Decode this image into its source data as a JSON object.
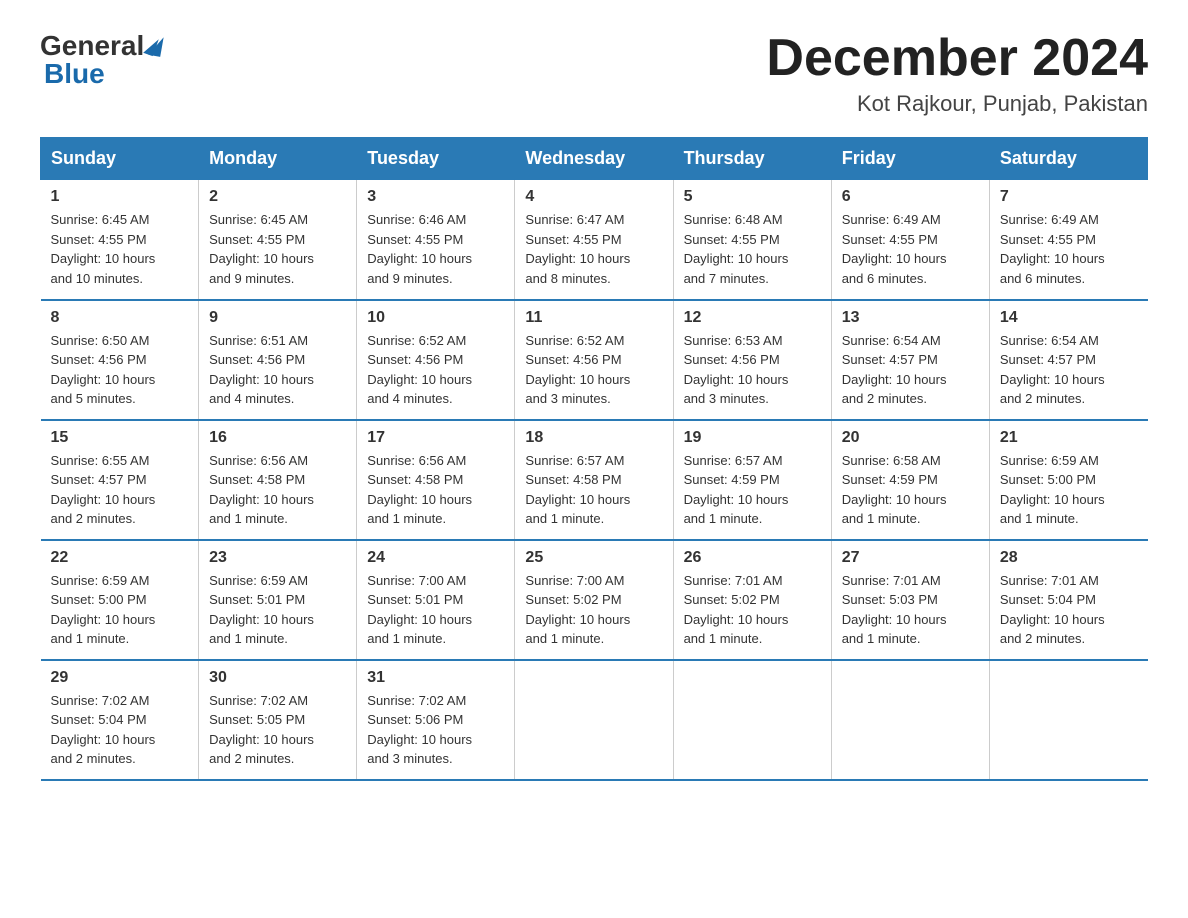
{
  "header": {
    "logo_general": "General",
    "logo_blue": "Blue",
    "main_title": "December 2024",
    "subtitle": "Kot Rajkour, Punjab, Pakistan"
  },
  "days_of_week": [
    "Sunday",
    "Monday",
    "Tuesday",
    "Wednesday",
    "Thursday",
    "Friday",
    "Saturday"
  ],
  "weeks": [
    [
      {
        "day": "1",
        "sunrise": "6:45 AM",
        "sunset": "4:55 PM",
        "daylight": "10 hours and 10 minutes."
      },
      {
        "day": "2",
        "sunrise": "6:45 AM",
        "sunset": "4:55 PM",
        "daylight": "10 hours and 9 minutes."
      },
      {
        "day": "3",
        "sunrise": "6:46 AM",
        "sunset": "4:55 PM",
        "daylight": "10 hours and 9 minutes."
      },
      {
        "day": "4",
        "sunrise": "6:47 AM",
        "sunset": "4:55 PM",
        "daylight": "10 hours and 8 minutes."
      },
      {
        "day": "5",
        "sunrise": "6:48 AM",
        "sunset": "4:55 PM",
        "daylight": "10 hours and 7 minutes."
      },
      {
        "day": "6",
        "sunrise": "6:49 AM",
        "sunset": "4:55 PM",
        "daylight": "10 hours and 6 minutes."
      },
      {
        "day": "7",
        "sunrise": "6:49 AM",
        "sunset": "4:55 PM",
        "daylight": "10 hours and 6 minutes."
      }
    ],
    [
      {
        "day": "8",
        "sunrise": "6:50 AM",
        "sunset": "4:56 PM",
        "daylight": "10 hours and 5 minutes."
      },
      {
        "day": "9",
        "sunrise": "6:51 AM",
        "sunset": "4:56 PM",
        "daylight": "10 hours and 4 minutes."
      },
      {
        "day": "10",
        "sunrise": "6:52 AM",
        "sunset": "4:56 PM",
        "daylight": "10 hours and 4 minutes."
      },
      {
        "day": "11",
        "sunrise": "6:52 AM",
        "sunset": "4:56 PM",
        "daylight": "10 hours and 3 minutes."
      },
      {
        "day": "12",
        "sunrise": "6:53 AM",
        "sunset": "4:56 PM",
        "daylight": "10 hours and 3 minutes."
      },
      {
        "day": "13",
        "sunrise": "6:54 AM",
        "sunset": "4:57 PM",
        "daylight": "10 hours and 2 minutes."
      },
      {
        "day": "14",
        "sunrise": "6:54 AM",
        "sunset": "4:57 PM",
        "daylight": "10 hours and 2 minutes."
      }
    ],
    [
      {
        "day": "15",
        "sunrise": "6:55 AM",
        "sunset": "4:57 PM",
        "daylight": "10 hours and 2 minutes."
      },
      {
        "day": "16",
        "sunrise": "6:56 AM",
        "sunset": "4:58 PM",
        "daylight": "10 hours and 1 minute."
      },
      {
        "day": "17",
        "sunrise": "6:56 AM",
        "sunset": "4:58 PM",
        "daylight": "10 hours and 1 minute."
      },
      {
        "day": "18",
        "sunrise": "6:57 AM",
        "sunset": "4:58 PM",
        "daylight": "10 hours and 1 minute."
      },
      {
        "day": "19",
        "sunrise": "6:57 AM",
        "sunset": "4:59 PM",
        "daylight": "10 hours and 1 minute."
      },
      {
        "day": "20",
        "sunrise": "6:58 AM",
        "sunset": "4:59 PM",
        "daylight": "10 hours and 1 minute."
      },
      {
        "day": "21",
        "sunrise": "6:59 AM",
        "sunset": "5:00 PM",
        "daylight": "10 hours and 1 minute."
      }
    ],
    [
      {
        "day": "22",
        "sunrise": "6:59 AM",
        "sunset": "5:00 PM",
        "daylight": "10 hours and 1 minute."
      },
      {
        "day": "23",
        "sunrise": "6:59 AM",
        "sunset": "5:01 PM",
        "daylight": "10 hours and 1 minute."
      },
      {
        "day": "24",
        "sunrise": "7:00 AM",
        "sunset": "5:01 PM",
        "daylight": "10 hours and 1 minute."
      },
      {
        "day": "25",
        "sunrise": "7:00 AM",
        "sunset": "5:02 PM",
        "daylight": "10 hours and 1 minute."
      },
      {
        "day": "26",
        "sunrise": "7:01 AM",
        "sunset": "5:02 PM",
        "daylight": "10 hours and 1 minute."
      },
      {
        "day": "27",
        "sunrise": "7:01 AM",
        "sunset": "5:03 PM",
        "daylight": "10 hours and 1 minute."
      },
      {
        "day": "28",
        "sunrise": "7:01 AM",
        "sunset": "5:04 PM",
        "daylight": "10 hours and 2 minutes."
      }
    ],
    [
      {
        "day": "29",
        "sunrise": "7:02 AM",
        "sunset": "5:04 PM",
        "daylight": "10 hours and 2 minutes."
      },
      {
        "day": "30",
        "sunrise": "7:02 AM",
        "sunset": "5:05 PM",
        "daylight": "10 hours and 2 minutes."
      },
      {
        "day": "31",
        "sunrise": "7:02 AM",
        "sunset": "5:06 PM",
        "daylight": "10 hours and 3 minutes."
      },
      null,
      null,
      null,
      null
    ]
  ],
  "labels": {
    "sunrise_prefix": "Sunrise: ",
    "sunset_prefix": "Sunset: ",
    "daylight_prefix": "Daylight: "
  }
}
